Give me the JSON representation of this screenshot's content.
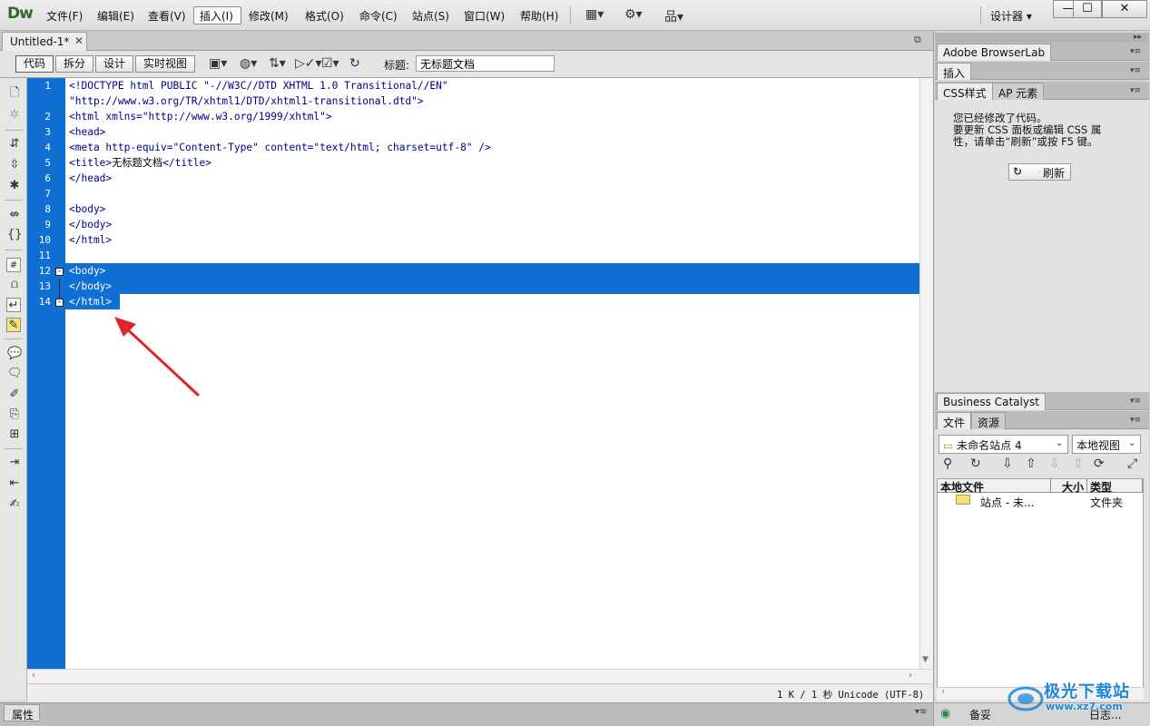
{
  "app": {
    "logo": "Dw",
    "workspace": "设计器",
    "workspace_arrow": "▾"
  },
  "menu": [
    "文件(F)",
    "编辑(E)",
    "查看(V)",
    "插入(I)",
    "修改(M)",
    "格式(O)",
    "命令(C)",
    "站点(S)",
    "窗口(W)",
    "帮助(H)"
  ],
  "window": {
    "minimize": "—",
    "maximize": "☐",
    "close": "✕"
  },
  "document": {
    "tab_label": "Untitled-1*",
    "close": "✕",
    "restore": "⧉"
  },
  "doc_toolbar": {
    "views": [
      "代码",
      "拆分",
      "设计",
      "实时视图"
    ],
    "title_label": "标题:",
    "title_value": "无标题文档"
  },
  "code_lines": [
    {
      "num": "1",
      "text": "<!DOCTYPE html PUBLIC \"-//W3C//DTD XHTML 1.0 Transitional//EN\""
    },
    {
      "num": "",
      "text": "\"http://www.w3.org/TR/xhtml1/DTD/xhtml1-transitional.dtd\">"
    },
    {
      "num": "2",
      "text": "<html xmlns=\"http://www.w3.org/1999/xhtml\">"
    },
    {
      "num": "3",
      "text": "<head>"
    },
    {
      "num": "4",
      "text": "<meta http-equiv=\"Content-Type\" content=\"text/html; charset=utf-8\" />"
    },
    {
      "num": "5",
      "text_pre": "<title>",
      "text_mid": "无标题文档",
      "text_post": "</title>"
    },
    {
      "num": "6",
      "text": "</head>"
    },
    {
      "num": "7",
      "text": ""
    },
    {
      "num": "8",
      "text": "<body>"
    },
    {
      "num": "9",
      "text": "</body>"
    },
    {
      "num": "10",
      "text": "</html>"
    },
    {
      "num": "11",
      "text": ""
    },
    {
      "num": "12",
      "text": "<body>",
      "selected": true
    },
    {
      "num": "13",
      "text": "</body>",
      "selected": true
    },
    {
      "num": "14",
      "text": "</html>",
      "selected": true
    }
  ],
  "status": {
    "text": "1 K / 1 秒 Unicode (UTF-8)"
  },
  "properties": {
    "label": "属性",
    "menu": "▾≡"
  },
  "panels": {
    "browserlab": "Adobe BrowserLab",
    "insert": "插入",
    "css_tabs": [
      "CSS样式",
      "AP 元素"
    ],
    "css_message_lines": [
      "您已经修改了代码。",
      "要更新 CSS 面板或编辑 CSS 属",
      "性，请单击“刷新”或按 F5 键。"
    ],
    "refresh_label": "刷新",
    "business_catalyst": "Business Catalyst",
    "file_tabs": [
      "文件",
      "资源"
    ],
    "site_select": "未命名站点 4",
    "view_select": "本地视图",
    "file_columns": [
      "本地文件",
      "大小",
      "类型"
    ],
    "file_row": {
      "name": "站点 - 未...",
      "type": "文件夹"
    },
    "log_ready": "备妥",
    "log_button": "日志..."
  },
  "watermark": {
    "text": "极光下载站",
    "url": "www.xz7.com"
  }
}
